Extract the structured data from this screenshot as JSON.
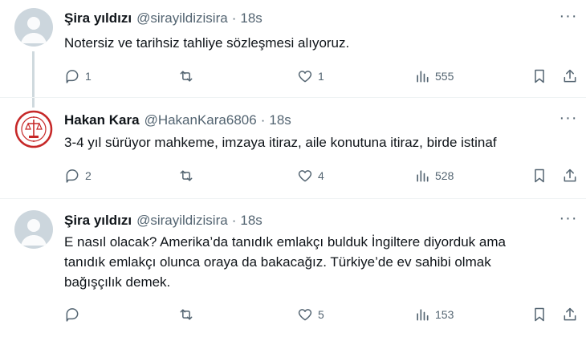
{
  "tweets": [
    {
      "name": "Şira yıldızı",
      "handle": "@sirayildizisira",
      "time": "18s",
      "text": "Notersiz ve tarihsiz tahliye sözleşmesi alıyoruz.",
      "replies": "1",
      "retweets": "",
      "likes": "1",
      "views": "555"
    },
    {
      "name": "Hakan Kara",
      "handle": "@HakanKara6806",
      "time": "18s",
      "text": "3-4 yıl sürüyor mahkeme, imzaya itiraz, aile konutuna itiraz, birde istinaf",
      "replies": "2",
      "retweets": "",
      "likes": "4",
      "views": "528"
    },
    {
      "name": "Şira yıldızı",
      "handle": "@sirayildizisira",
      "time": "18s",
      "text_lines": [
        "E nasıl olacak? Amerika’da tanıdık emlakçı bulduk İngiltere diyorduk ama",
        "tanıdık emlakçı olunca oraya da bakacağız. Türkiye’de ev sahibi olmak",
        "bağışçılık demek."
      ],
      "replies": "",
      "retweets": "",
      "likes": "5",
      "views": "153"
    }
  ],
  "separator": "·",
  "more_glyph": "···",
  "icons": [
    "reply-icon",
    "retweet-icon",
    "like-icon",
    "views-icon",
    "bookmark-icon",
    "share-icon"
  ],
  "colors": {
    "text": "#0f1419",
    "secondary": "#536471",
    "thread_line": "#cfd9de",
    "avatar_bg": "#ccd6dd"
  }
}
